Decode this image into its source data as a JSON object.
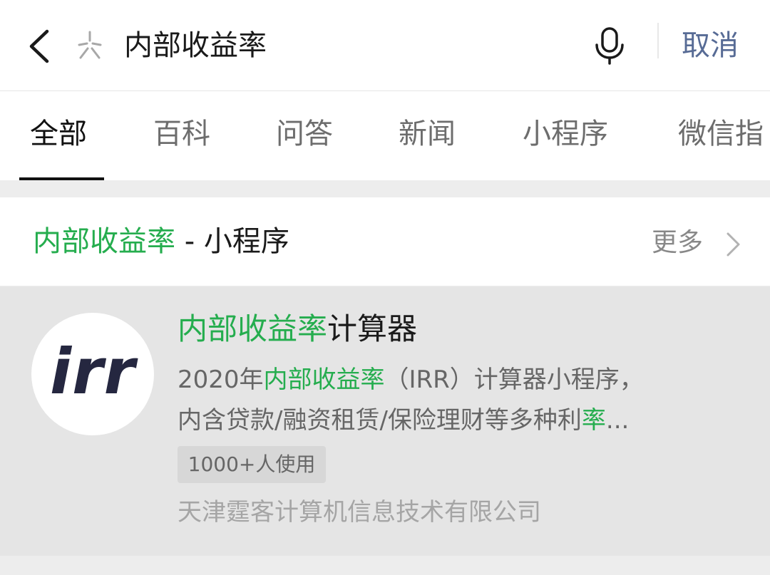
{
  "search": {
    "query": "内部收益率",
    "cancel_label": "取消"
  },
  "tabs": [
    {
      "label": "全部",
      "active": true
    },
    {
      "label": "百科",
      "active": false
    },
    {
      "label": "问答",
      "active": false
    },
    {
      "label": "新闻",
      "active": false
    },
    {
      "label": "小程序",
      "active": false
    },
    {
      "label": "微信指",
      "active": false
    }
  ],
  "section": {
    "title_highlight": "内部收益率",
    "title_rest": " - 小程序",
    "more_label": "更多"
  },
  "result": {
    "avatar_text": "irr",
    "title_highlight": "内部收益率",
    "title_rest": "计算器",
    "desc_line1_prefix": "2020年",
    "desc_line1_highlight": "内部收益率",
    "desc_line1_suffix": "（IRR）计算器小程序，",
    "desc_line2_prefix": "内含贷款/融资租赁/保险理财等多种利",
    "desc_line2_highlight": "率",
    "desc_line2_suffix": "...",
    "usage_badge": "1000+人使用",
    "developer": "天津霆客计算机信息技术有限公司"
  },
  "colors": {
    "highlight": "#25ad4e",
    "link": "#576b95",
    "background": "#ededed"
  },
  "icons": {
    "back": "chevron-left-icon",
    "search_type": "sparkle-icon",
    "mic": "microphone-icon",
    "more": "chevron-right-icon"
  }
}
